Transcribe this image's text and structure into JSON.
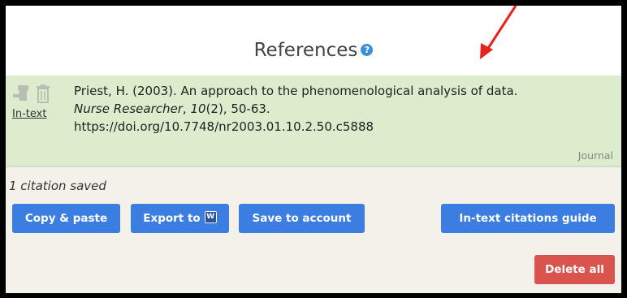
{
  "header": {
    "title": "References",
    "help_icon": "?"
  },
  "citation": {
    "intext_label": "In-text",
    "line1": "Priest, H. (2003). An approach to the phenomenological analysis of data.",
    "journal": "Nurse Researcher",
    "volume": "10",
    "issue_pages": "(2), 50-63.",
    "sep": ", ",
    "doi": "https://doi.org/10.7748/nr2003.01.10.2.50.c5888",
    "type": "Journal"
  },
  "saved": {
    "count_text": "1 citation saved"
  },
  "buttons": {
    "copy_paste": "Copy & paste",
    "export_to": "Export to",
    "save_account": "Save to account",
    "intext_guide": "In-text citations guide",
    "delete_all": "Delete all"
  },
  "colors": {
    "primary": "#3b7de0",
    "danger": "#d9534f",
    "citation_bg": "#dceccd",
    "annotation": "#e8231f"
  }
}
